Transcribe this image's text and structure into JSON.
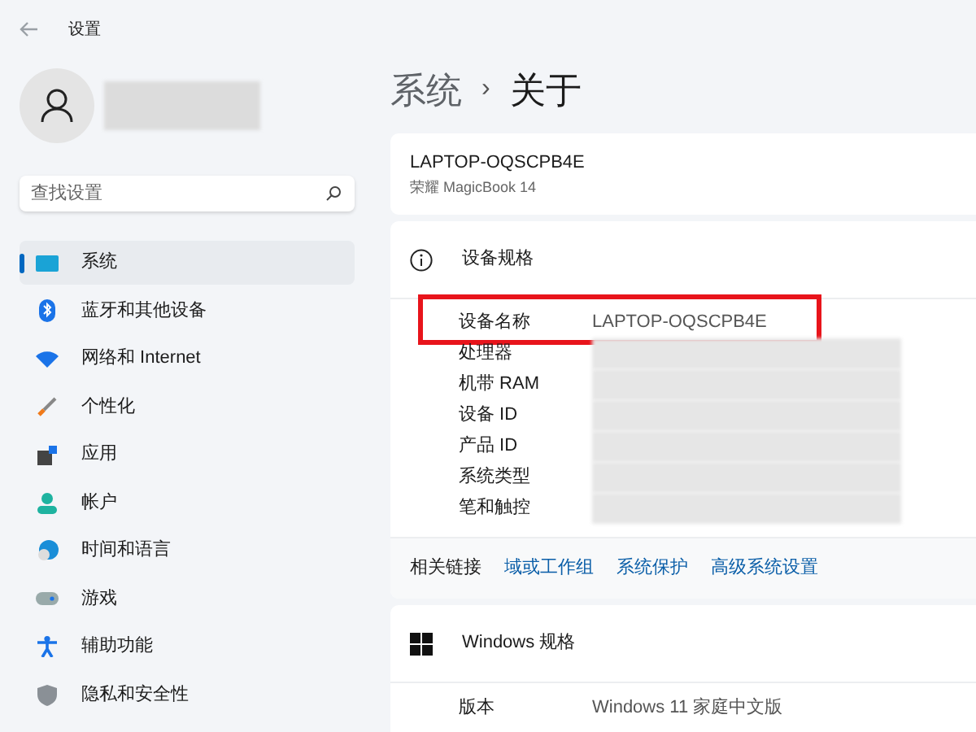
{
  "window": {
    "title": "设置"
  },
  "search": {
    "placeholder": "查找设置"
  },
  "sidebar": {
    "items": [
      {
        "label": "系统",
        "selected": true
      },
      {
        "label": "蓝牙和其他设备",
        "selected": false
      },
      {
        "label": "网络和 Internet",
        "selected": false
      },
      {
        "label": "个性化",
        "selected": false
      },
      {
        "label": "应用",
        "selected": false
      },
      {
        "label": "帐户",
        "selected": false
      },
      {
        "label": "时间和语言",
        "selected": false
      },
      {
        "label": "游戏",
        "selected": false
      },
      {
        "label": "辅助功能",
        "selected": false
      },
      {
        "label": "隐私和安全性",
        "selected": false
      }
    ]
  },
  "breadcrumb": {
    "parent": "系统",
    "separator": "›",
    "current": "关于"
  },
  "device_card": {
    "name": "LAPTOP-OQSCPB4E",
    "model": "荣耀 MagicBook 14"
  },
  "device_specs": {
    "title": "设备规格",
    "rows": [
      {
        "label": "设备名称",
        "value": "LAPTOP-OQSCPB4E",
        "redacted": false,
        "highlighted": true
      },
      {
        "label": "处理器",
        "redacted": true,
        "highlighted": false
      },
      {
        "label": "机带 RAM",
        "redacted": true,
        "highlighted": false
      },
      {
        "label": "设备 ID",
        "redacted": true,
        "highlighted": false
      },
      {
        "label": "产品 ID",
        "redacted": true,
        "highlighted": false
      },
      {
        "label": "系统类型",
        "redacted": true,
        "highlighted": false
      },
      {
        "label": "笔和触控",
        "redacted": true,
        "highlighted": false
      }
    ]
  },
  "related_links": {
    "label": "相关链接",
    "links": [
      "域或工作组",
      "系统保护",
      "高级系统设置"
    ]
  },
  "windows_specs": {
    "title": "Windows 规格",
    "rows": [
      {
        "label": "版本",
        "value": "Windows 11 家庭中文版"
      }
    ]
  }
}
